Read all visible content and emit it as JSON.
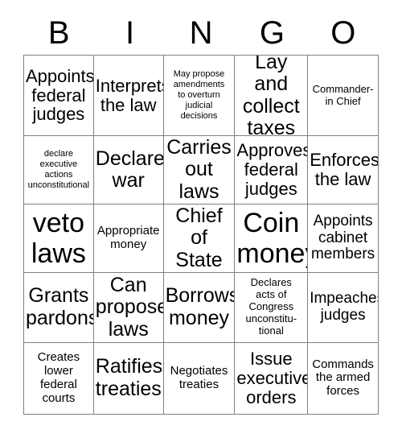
{
  "card": {
    "title": "BINGO",
    "background_color": "#ffffff",
    "text_color": "#000000",
    "border_color": "#808080",
    "header_letters": [
      "B",
      "I",
      "N",
      "G",
      "O"
    ],
    "rows": 5,
    "columns": 5,
    "cells": [
      [
        {
          "text": "Appoints\nfederal\njudges",
          "size": "lg"
        },
        {
          "text": "Interprets\nthe law",
          "size": "lg"
        },
        {
          "text": "May propose\namendments\nto overturn\njudicial\ndecisions",
          "size": "xxs"
        },
        {
          "text": "Lay and\ncollect\ntaxes",
          "size": "xl"
        },
        {
          "text": "Commander-\nin Chief",
          "size": "xs"
        }
      ],
      [
        {
          "text": "declare\nexecutive\nactions\nunconstitutional",
          "size": "xxs"
        },
        {
          "text": "Declares\nwar",
          "size": "xl"
        },
        {
          "text": "Carries\nout\nlaws",
          "size": "xl"
        },
        {
          "text": "Approves\nfederal\njudges",
          "size": "lg"
        },
        {
          "text": "Enforces\nthe law",
          "size": "lg"
        }
      ],
      [
        {
          "text": "veto\nlaws",
          "size": "xxl"
        },
        {
          "text": "Appropriate\nmoney",
          "size": "sm"
        },
        {
          "text": "Chief\nof\nState",
          "size": "xl"
        },
        {
          "text": "Coin\nmoney",
          "size": "xxl"
        },
        {
          "text": "Appoints\ncabinet\nmembers",
          "size": "md"
        }
      ],
      [
        {
          "text": "Grants\npardons",
          "size": "xl"
        },
        {
          "text": "Can\npropose\nlaws",
          "size": "xl"
        },
        {
          "text": "Borrows\nmoney",
          "size": "xl"
        },
        {
          "text": "Declares\nacts of\nCongress\nunconstitu-\ntional",
          "size": "xs"
        },
        {
          "text": "Impeaches\njudges",
          "size": "md"
        }
      ],
      [
        {
          "text": "Creates\nlower\nfederal\ncourts",
          "size": "sm"
        },
        {
          "text": "Ratifies\ntreaties",
          "size": "xl"
        },
        {
          "text": "Negotiates\ntreaties",
          "size": "sm"
        },
        {
          "text": "Issue\nexecutive\norders",
          "size": "lg"
        },
        {
          "text": "Commands\nthe armed\nforces",
          "size": "sm"
        }
      ]
    ]
  }
}
